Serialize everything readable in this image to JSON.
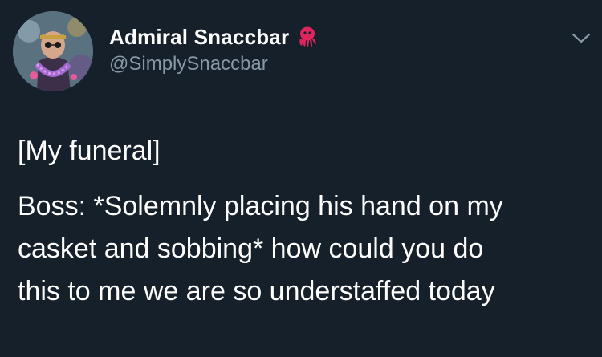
{
  "author": {
    "display_name": "Admiral Snaccbar",
    "handle": "@SimplySnaccbar",
    "name_emoji": "octopus-icon"
  },
  "menu": {
    "icon": "chevron-down-icon"
  },
  "tweet": {
    "line1": "[My funeral]",
    "body_lines": [
      "Boss: *Solemnly placing his hand on my",
      "casket and sobbing* how could you do",
      "this to me we are so understaffed today"
    ]
  },
  "colors": {
    "background": "#15202b",
    "text": "#ffffff",
    "secondary_text": "#8899a6",
    "octopus": "#e0245e"
  }
}
